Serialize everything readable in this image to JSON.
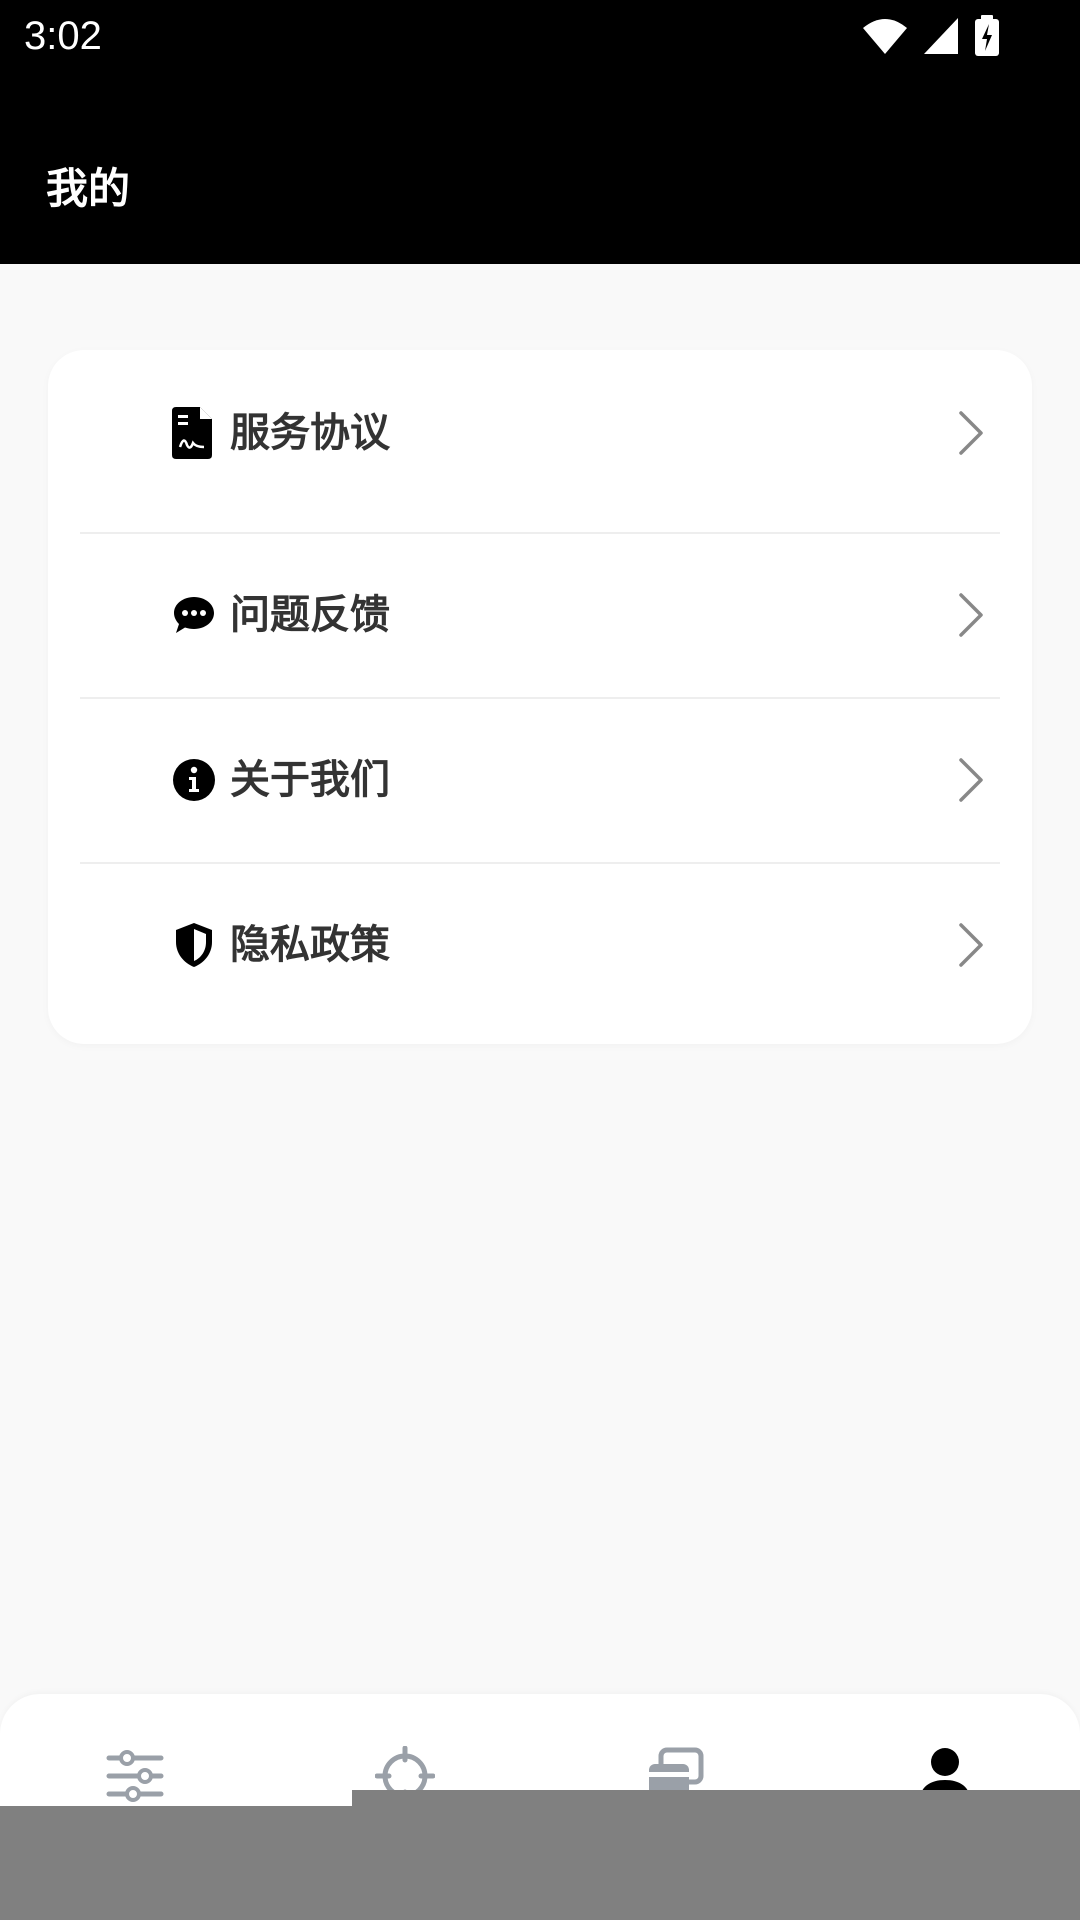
{
  "status_bar": {
    "time": "3:02",
    "icons": [
      "wifi-icon",
      "cellular-signal-icon",
      "battery-charging-icon"
    ]
  },
  "header": {
    "title": "我的"
  },
  "menu": {
    "items": [
      {
        "label": "服务协议",
        "icon": "document-signature-icon"
      },
      {
        "label": "问题反馈",
        "icon": "chat-bubble-icon"
      },
      {
        "label": "关于我们",
        "icon": "info-icon"
      },
      {
        "label": "隐私政策",
        "icon": "shield-icon"
      }
    ]
  },
  "bottom_nav": {
    "items": [
      {
        "icon": "sliders-icon",
        "active": false
      },
      {
        "icon": "crosshair-icon",
        "active": false
      },
      {
        "icon": "cards-icon",
        "active": false
      },
      {
        "icon": "profile-icon",
        "active": true
      }
    ]
  },
  "colors": {
    "header_bg": "#000000",
    "page_bg": "#f9f9f9",
    "card_bg": "#ffffff",
    "label_text": "#333333",
    "nav_inactive": "#9aa0a8",
    "nav_active": "#000000",
    "overlay": "#808080"
  }
}
